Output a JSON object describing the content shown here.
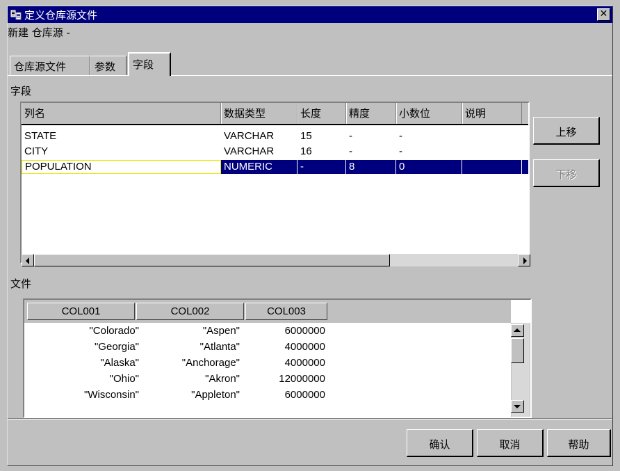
{
  "window": {
    "title": "定义仓库源文件",
    "close_label": "✕",
    "subtitle": "新建 仓库源 -"
  },
  "tabs": [
    {
      "label": "仓库源文件",
      "active": false
    },
    {
      "label": "参数",
      "active": false
    },
    {
      "label": "字段",
      "active": true
    }
  ],
  "fields": {
    "group_label": "字段",
    "columns": [
      "列名",
      "数据类型",
      "长度",
      "精度",
      "小数位",
      "说明"
    ],
    "rows": [
      {
        "name": "STATE",
        "type": "VARCHAR",
        "length": "15",
        "precision": "-",
        "scale": "-",
        "desc": ""
      },
      {
        "name": "CITY",
        "type": "VARCHAR",
        "length": "16",
        "precision": "-",
        "scale": "-",
        "desc": ""
      },
      {
        "name": "POPULATION",
        "type": "NUMERIC",
        "length": "-",
        "precision": "8",
        "scale": "0",
        "desc": "",
        "selected": true
      }
    ],
    "move_up_label": "上移",
    "move_down_label": "下移"
  },
  "file": {
    "group_label": "文件",
    "columns": [
      "COL001",
      "COL002",
      "COL003"
    ],
    "rows": [
      [
        "\"Colorado\"",
        "\"Aspen\"",
        "6000000"
      ],
      [
        "\"Georgia\"",
        "\"Atlanta\"",
        "4000000"
      ],
      [
        "\"Alaska\"",
        "\"Anchorage\"",
        "4000000"
      ],
      [
        "\"Ohio\"",
        "\"Akron\"",
        "12000000"
      ],
      [
        "\"Wisconsin\"",
        "\"Appleton\"",
        "6000000"
      ]
    ]
  },
  "buttons": {
    "ok": "确认",
    "cancel": "取消",
    "help": "帮助"
  },
  "colors": {
    "titlebar": "#00007f",
    "selection": "#00007f",
    "face": "#c0c0c0"
  }
}
